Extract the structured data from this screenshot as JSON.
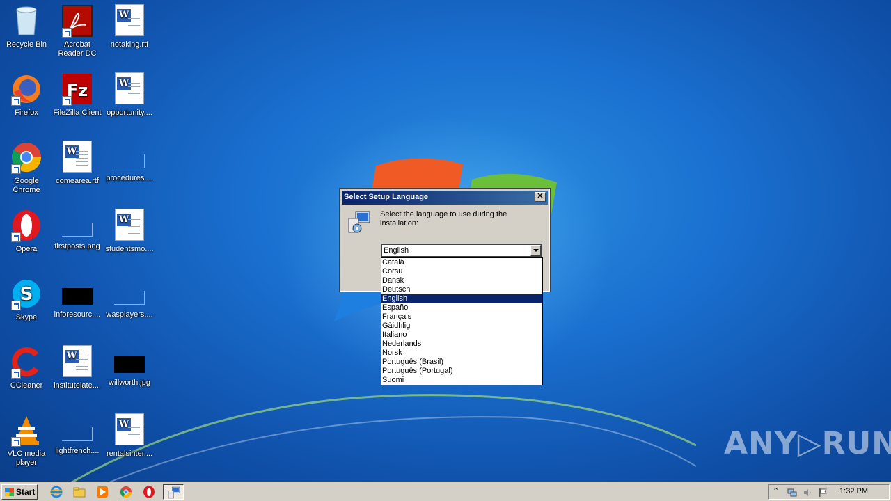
{
  "desktop": {
    "icons": [
      {
        "label": "Recycle Bin"
      },
      {
        "label": "Acrobat Reader DC"
      },
      {
        "label": "notaking.rtf"
      },
      {
        "label": "Firefox"
      },
      {
        "label": "FileZilla Client"
      },
      {
        "label": "opportunity...."
      },
      {
        "label": "Google Chrome"
      },
      {
        "label": "comearea.rtf"
      },
      {
        "label": "procedures...."
      },
      {
        "label": "Opera"
      },
      {
        "label": "firstposts.png"
      },
      {
        "label": "studentsmo...."
      },
      {
        "label": "Skype"
      },
      {
        "label": "inforesourc...."
      },
      {
        "label": "wasplayers...."
      },
      {
        "label": "CCleaner"
      },
      {
        "label": "institutelate...."
      },
      {
        "label": "willworth.jpg"
      },
      {
        "label": "VLC media player"
      },
      {
        "label": "lightfrench...."
      },
      {
        "label": "rentalsinter...."
      }
    ]
  },
  "dialog": {
    "title": "Select Setup Language",
    "close_label": "✕",
    "prompt": "Select the language to use during the installation:",
    "selected_value": "English",
    "options": [
      "Català",
      "Corsu",
      "Dansk",
      "Deutsch",
      "English",
      "Español",
      "Français",
      "Gàidhlig",
      "Italiano",
      "Nederlands",
      "Norsk",
      "Português (Brasil)",
      "Português (Portugal)",
      "Suomi"
    ],
    "selected_index": 4
  },
  "taskbar": {
    "start_label": "Start",
    "clock": "1:32 PM",
    "tray_chevron": "⌃"
  },
  "watermark": "ANY▷RUN",
  "colors": {
    "titlebar_start": "#0a246a",
    "titlebar_end": "#3a6ea5",
    "selection": "#0a246a",
    "dialog_face": "#d4d0c8"
  },
  "icons": [
    "recycle-bin-icon",
    "acrobat-icon",
    "word-doc-icon",
    "firefox-icon",
    "filezilla-icon",
    "chrome-icon",
    "opera-icon",
    "skype-icon",
    "ccleaner-icon",
    "vlc-icon",
    "setup-computer-icon",
    "ie-icon",
    "explorer-icon",
    "media-player-icon",
    "flag-icon",
    "volume-icon",
    "network-icon"
  ]
}
